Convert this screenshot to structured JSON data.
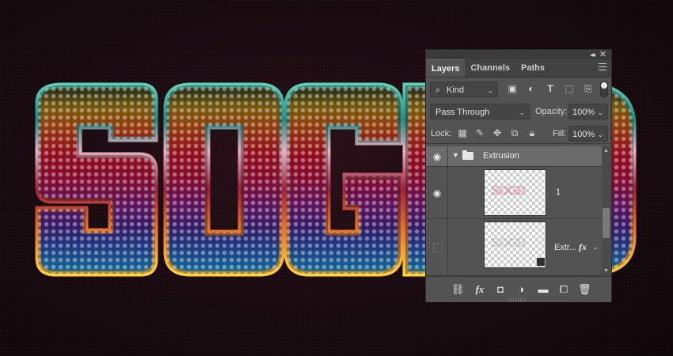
{
  "canvas": {
    "text": "SOGD",
    "background_color": "#1b0c12"
  },
  "panel": {
    "tabs": [
      {
        "label": "Layers",
        "active": true
      },
      {
        "label": "Channels",
        "active": false
      },
      {
        "label": "Paths",
        "active": false
      }
    ],
    "filter": {
      "kind_label": "Kind",
      "filter_icons": [
        "image-filter-icon",
        "adjustment-filter-icon",
        "type-filter-icon",
        "shape-filter-icon",
        "smart-object-filter-icon"
      ]
    },
    "blend": {
      "mode": "Pass Through",
      "opacity_label": "Opacity:",
      "opacity_value": "100%"
    },
    "lock": {
      "label": "Lock:",
      "fill_label": "Fill:",
      "fill_value": "100%"
    },
    "layers": [
      {
        "type": "group",
        "name": "Extrusion",
        "visible": true,
        "expanded": true
      },
      {
        "type": "smart",
        "name": "1",
        "visible": true
      },
      {
        "type": "smart",
        "name": "Extr...",
        "visible": false,
        "has_fx": true,
        "fx_label": "fx"
      }
    ],
    "bottom_icons": [
      "link-layers-icon",
      "add-style-icon",
      "add-mask-icon",
      "adjustment-layer-icon",
      "new-group-icon",
      "new-layer-icon",
      "delete-layer-icon"
    ],
    "bottom_fx_label": "fx"
  }
}
